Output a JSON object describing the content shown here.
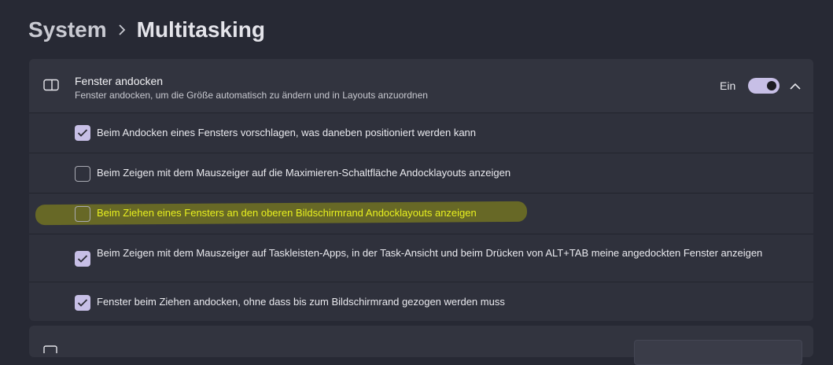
{
  "breadcrumb": {
    "parent": "System",
    "current": "Multitasking"
  },
  "snap_windows": {
    "title": "Fenster andocken",
    "description": "Fenster andocken, um die Größe automatisch zu ändern und in Layouts anzuordnen",
    "status": "Ein",
    "toggle_on": true,
    "expanded": true,
    "icon": "snap-window-icon",
    "options": [
      {
        "label": "Beim Andocken eines Fensters vorschlagen, was daneben positioniert werden kann",
        "checked": true
      },
      {
        "label": "Beim Zeigen mit dem Mauszeiger auf die Maximieren-Schaltfläche Andocklayouts anzeigen",
        "checked": false
      },
      {
        "label": "Beim Ziehen eines Fensters an den oberen Bildschirmrand Andocklayouts anzeigen",
        "checked": false,
        "highlighted": true
      },
      {
        "label": "Beim Zeigen mit dem Mauszeiger auf Taskleisten-Apps, in der Task-Ansicht und beim Drücken von ALT+TAB meine angedockten Fenster anzeigen",
        "checked": true
      },
      {
        "label": "Fenster beim Ziehen andocken, ohne dass bis zum Bildschirmrand gezogen werden muss",
        "checked": true
      }
    ]
  },
  "colors": {
    "background": "#272934",
    "panel": "#2f313c",
    "accent": "#c7bfe6",
    "highlight_text": "#e8f01f"
  }
}
